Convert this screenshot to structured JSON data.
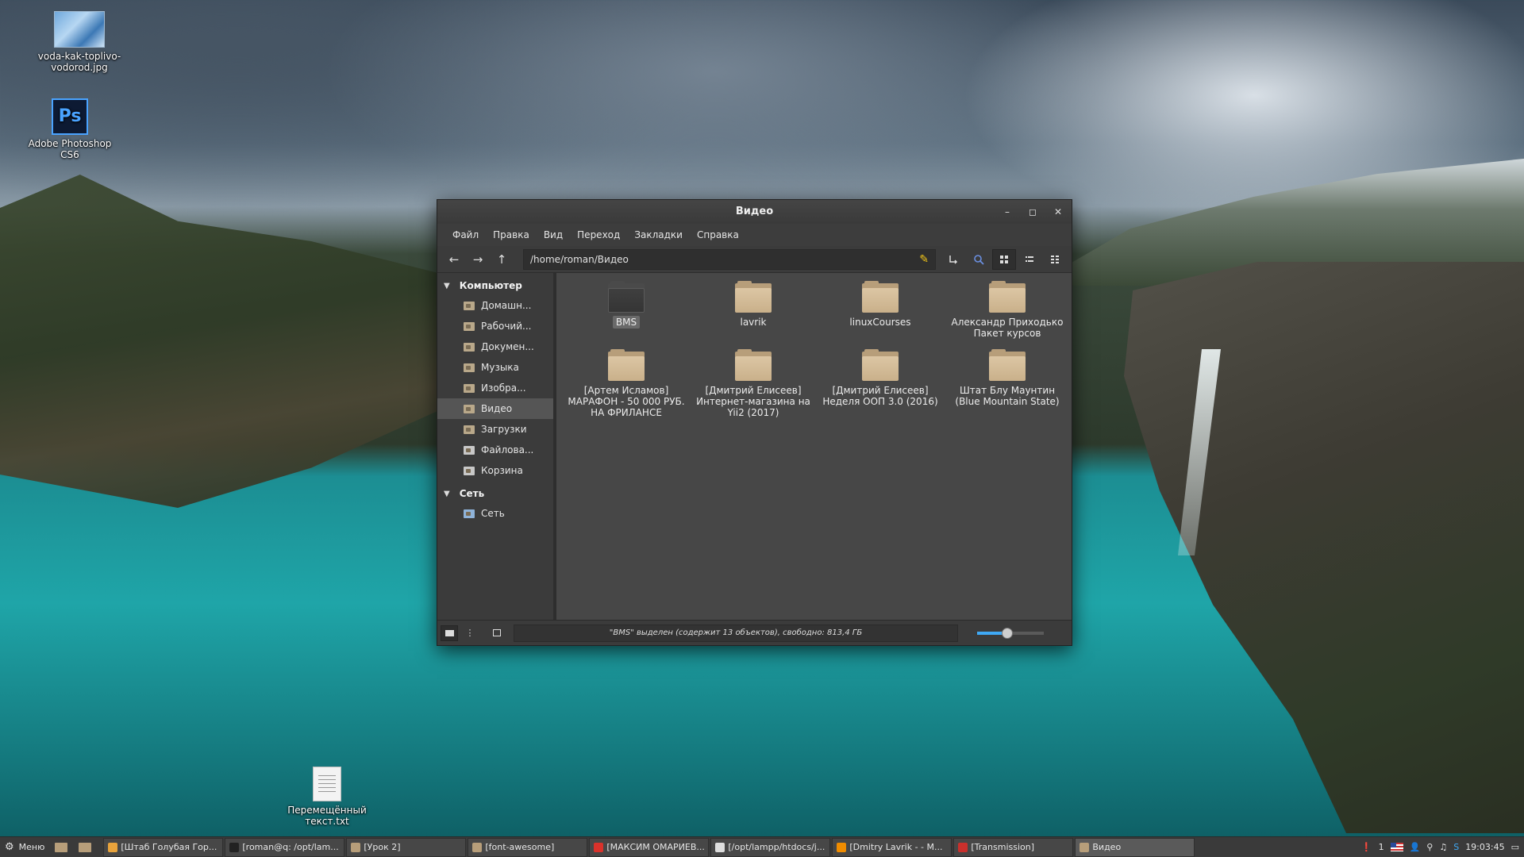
{
  "desktop": {
    "icons": [
      {
        "label": "voda-kak-toplivo-vodorod.jpg",
        "icon": "image-file-icon"
      },
      {
        "label": "Adobe Photoshop CS6",
        "icon": "photoshop-icon",
        "logo_text": "Ps"
      },
      {
        "label": "Перемещённый текст.txt",
        "icon": "text-file-icon"
      }
    ]
  },
  "window": {
    "title": "Видео",
    "controls": {
      "minimize": "–",
      "maximize": "◻",
      "close": "✕"
    },
    "menu": [
      "Файл",
      "Правка",
      "Вид",
      "Переход",
      "Закладки",
      "Справка"
    ],
    "toolbar": {
      "address": "/home/roman/Видео",
      "back": "←",
      "forward": "→",
      "up": "↑"
    },
    "sidebar": {
      "sections": [
        {
          "title": "Компьютер",
          "items": [
            {
              "label": "Домашн...",
              "icon": "home-folder-icon"
            },
            {
              "label": "Рабочий...",
              "icon": "desktop-folder-icon"
            },
            {
              "label": "Докумен...",
              "icon": "documents-folder-icon"
            },
            {
              "label": "Музыка",
              "icon": "music-folder-icon"
            },
            {
              "label": "Изобра...",
              "icon": "pictures-folder-icon"
            },
            {
              "label": "Видео",
              "icon": "videos-folder-icon",
              "selected": true
            },
            {
              "label": "Загрузки",
              "icon": "downloads-folder-icon"
            },
            {
              "label": "Файлова...",
              "icon": "filesystem-icon"
            },
            {
              "label": "Корзина",
              "icon": "trash-icon"
            }
          ]
        },
        {
          "title": "Сеть",
          "items": [
            {
              "label": "Сеть",
              "icon": "network-icon"
            }
          ]
        }
      ]
    },
    "files": [
      {
        "name": "BMS",
        "selected": true
      },
      {
        "name": "lavrik"
      },
      {
        "name": "linuxCourses"
      },
      {
        "name": "Александр Приходько Пакет курсов"
      },
      {
        "name": "[Артем Исламов] МАРАФОН - 50 000 РУБ. НА ФРИЛАНСЕ"
      },
      {
        "name": "[Дмитрий Елисеев] Интернет-магазина на Yii2 (2017)"
      },
      {
        "name": "[Дмитрий Елисеев] Неделя ООП 3.0 (2016)"
      },
      {
        "name": "Штат Блу Маунтин (Blue Mountain State)"
      }
    ],
    "status": "\"BMS\" выделен (содержит 13 объектов), свободно: 813,4 ГБ",
    "zoom_level": 0.45,
    "accent": "#3fa9f5"
  },
  "taskbar": {
    "menu_label": "Меню",
    "tasks": [
      {
        "label": "[Штаб Голубая Гор...",
        "icon": "chrome-icon",
        "color": "#e8a33c"
      },
      {
        "label": "[roman@q: /opt/lam...",
        "icon": "terminal-icon",
        "color": "#222222"
      },
      {
        "label": "[Урок 2]",
        "icon": "folder-icon",
        "color": "#b79e7a"
      },
      {
        "label": "[font-awesome]",
        "icon": "folder-icon",
        "color": "#b79e7a"
      },
      {
        "label": "[МАКСИМ ОМАРИЕВ...",
        "icon": "opera-icon",
        "color": "#d9322b"
      },
      {
        "label": "[/opt/lampp/htdocs/j...",
        "icon": "editor-icon",
        "color": "#dddddd"
      },
      {
        "label": "[Dmitry Lavrik - - M...",
        "icon": "vlc-icon",
        "color": "#f08c00"
      },
      {
        "label": "[Transmission]",
        "icon": "transmission-icon",
        "color": "#c9302c"
      },
      {
        "label": "Видео",
        "icon": "folder-icon",
        "color": "#b79e7a",
        "active": true
      }
    ],
    "tray": {
      "notification_count": "1",
      "keyboard_layout": "us-flag",
      "clock": "19:03:45"
    }
  }
}
